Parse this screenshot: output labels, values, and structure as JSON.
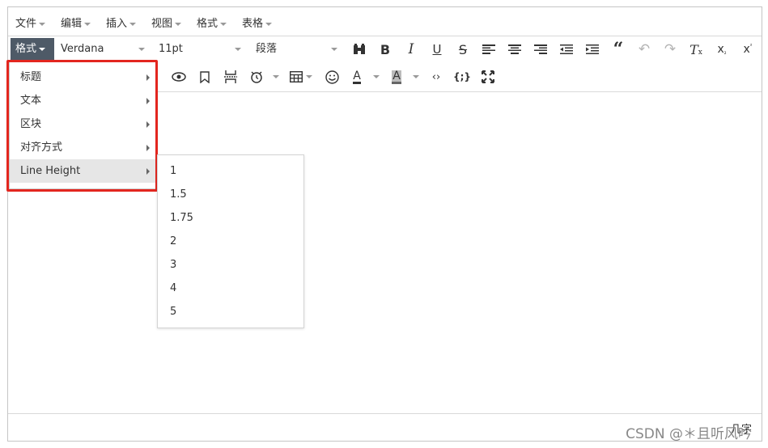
{
  "menubar": {
    "items": [
      "文件",
      "编辑",
      "插入",
      "视图",
      "格式",
      "表格"
    ]
  },
  "toolbar": {
    "format_label": "格式",
    "font_family": "Verdana",
    "font_size": "11pt",
    "block_format": "段落",
    "row1_icons": [
      "find-icon",
      "bold-icon",
      "italic-icon",
      "underline-icon",
      "strikethrough-icon",
      "align-left-icon",
      "align-center-icon",
      "align-right-icon",
      "outdent-icon",
      "indent-icon",
      "blockquote-icon",
      "undo-icon",
      "redo-icon",
      "clear-format-icon",
      "subscript-icon",
      "superscript-icon"
    ],
    "row2_icons": [
      "preview-icon",
      "bookmark-icon",
      "page-break-icon",
      "datetime-icon",
      "table-icon",
      "emoticons-icon",
      "text-color-icon",
      "background-color-icon",
      "code-icon",
      "code-sample-icon",
      "fullscreen-icon"
    ]
  },
  "format_menu": {
    "items": [
      {
        "label": "标题"
      },
      {
        "label": "文本"
      },
      {
        "label": "区块"
      },
      {
        "label": "对齐方式"
      },
      {
        "label": "Line Height"
      }
    ],
    "active_index": 4
  },
  "line_height_menu": {
    "options": [
      "1",
      "1.5",
      "1.75",
      "2",
      "3",
      "4",
      "5"
    ]
  },
  "statusbar": {
    "word_count": "几字"
  },
  "watermark": "CSDN @＊且听风吟",
  "colors": {
    "highlight_border": "#e3261f",
    "format_button_bg": "#4e5a67",
    "active_item_bg": "#e6e6e6"
  }
}
